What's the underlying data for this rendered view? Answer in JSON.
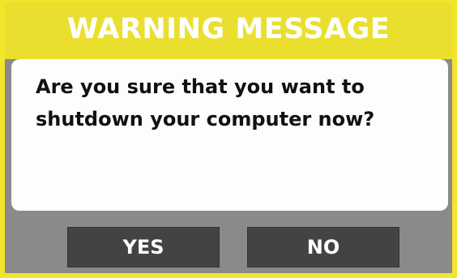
{
  "dialog": {
    "title": "WARNING MESSAGE",
    "message": "Are you sure that you want to shutdown your computer now?",
    "buttons": {
      "yes_label": "YES",
      "no_label": "NO"
    }
  },
  "colors": {
    "title_bar": "#eadf2f",
    "frame": "#8a8a8a",
    "message_panel": "#fdfdfd",
    "button": "#434343",
    "button_text": "#ffffff"
  }
}
